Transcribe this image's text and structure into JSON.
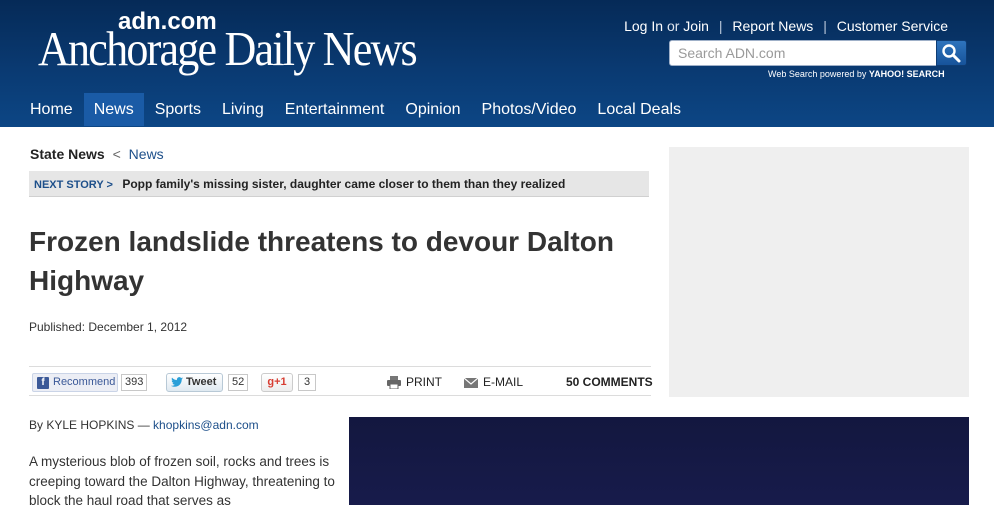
{
  "header": {
    "logo_small": "adn.com",
    "logo_big": "Anchorage Daily News",
    "links": {
      "login": "Log In",
      "or": "or",
      "join": "Join",
      "report_news": "Report News",
      "customer_service": "Customer Service"
    },
    "search": {
      "placeholder": "Search ADN.com",
      "powered_text": "Web Search powered by",
      "powered_brand": "YAHOO! SEARCH"
    }
  },
  "nav": {
    "items": [
      {
        "label": "Home"
      },
      {
        "label": "News"
      },
      {
        "label": "Sports"
      },
      {
        "label": "Living"
      },
      {
        "label": "Entertainment"
      },
      {
        "label": "Opinion"
      },
      {
        "label": "Photos/Video"
      },
      {
        "label": "Local Deals"
      }
    ],
    "active": "News"
  },
  "breadcrumb": {
    "section": "State News",
    "separator": "<",
    "parent": "News"
  },
  "next_story": {
    "label": "NEXT STORY >",
    "title": "Popp family's missing sister, daughter came closer to them than they realized"
  },
  "article": {
    "headline": "Frozen landslide threatens to devour Dalton Highway",
    "published": "Published: December 1, 2012",
    "byline_prefix": "By KYLE HOPKINS —",
    "byline_email": "khopkins@adn.com",
    "body_visible": "A mysterious blob of frozen soil, rocks and trees is creeping toward the Dalton Highway, threatening to block the haul road that serves as"
  },
  "share": {
    "recommend_label": "Recommend",
    "recommend_count": "393",
    "tweet_label": "Tweet",
    "tweet_count": "52",
    "gplus_label": "+1",
    "gplus_count": "3",
    "print_label": "PRINT",
    "email_label": "E-MAIL",
    "comments_label": "50 COMMENTS"
  },
  "colors": {
    "header_bg": "#0a3a72",
    "nav_active": "#1a5ba6",
    "link": "#1d4f8a",
    "ad_bg": "#efefef",
    "photo_bg": "#161a46"
  }
}
